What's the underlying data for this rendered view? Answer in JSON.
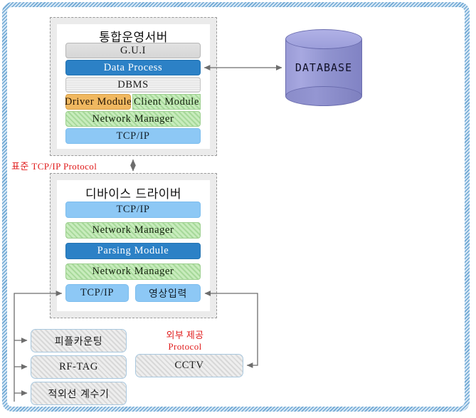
{
  "diagram": {
    "title_hidden": "",
    "server_panel": {
      "title": "통합운영서버",
      "rows": [
        {
          "label": "G.U.I",
          "style": "grey"
        },
        {
          "label": "Data Process",
          "style": "blue"
        },
        {
          "label": "DBMS",
          "style": "lines"
        },
        {
          "label": "Driver Module",
          "style": "orange"
        },
        {
          "label": "Client Module",
          "style": "greenhatch"
        },
        {
          "label": "Network Manager",
          "style": "greenhatch"
        },
        {
          "label": "TCP/IP",
          "style": "lightblue"
        }
      ]
    },
    "driver_panel": {
      "title": "디바이스 드라이버",
      "rows": [
        {
          "label": "TCP/IP",
          "style": "lightblue"
        },
        {
          "label": "Network Manager",
          "style": "greenhatch"
        },
        {
          "label": "Parsing Module",
          "style": "blue"
        },
        {
          "label": "Network Manager",
          "style": "greenhatch"
        },
        {
          "label": "TCP/IP",
          "style": "lightblue"
        },
        {
          "label": "영상입력",
          "style": "lightblue"
        }
      ]
    },
    "database": {
      "label": "DATABASE"
    },
    "protocol_labels": {
      "standard": "표준 TCP/IP Protocol",
      "external_line1": "외부 제공",
      "external_line2": "Protocol"
    },
    "devices": [
      {
        "label": "피플카운팅"
      },
      {
        "label": "RF-TAG"
      },
      {
        "label": "적외선 계수기"
      }
    ],
    "cctv": {
      "label": "CCTV"
    },
    "colors": {
      "accent_blue": "#2c81c6",
      "light_blue": "#8dc8f5",
      "green_hatch": "#a7d99a",
      "orange": "#f0b860",
      "database_purple": "#9496d2",
      "protocol_red": "#e01b1b",
      "frame_blue": "#6fa8d4",
      "panel_grey": "#ebebeb",
      "wire_grey": "#6d6d6d"
    }
  }
}
